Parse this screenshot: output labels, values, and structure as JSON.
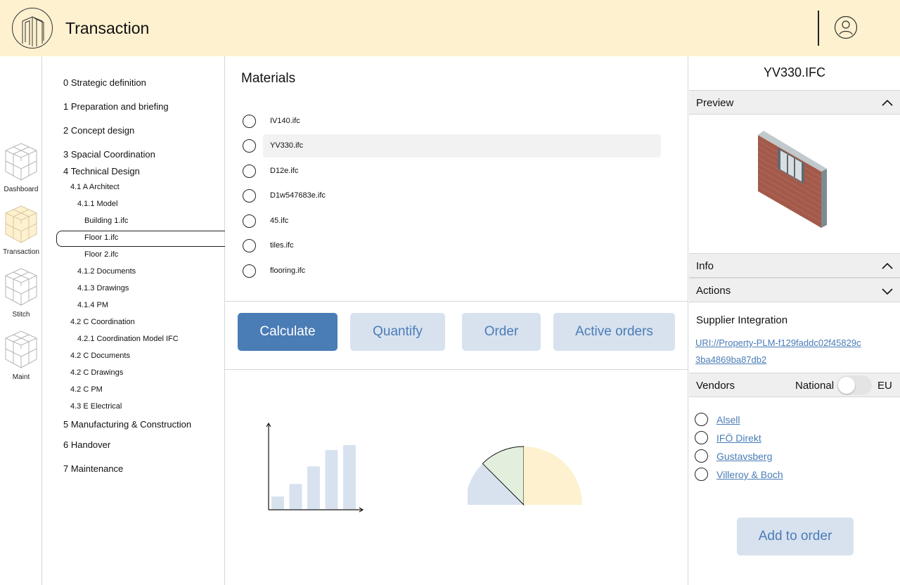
{
  "header": {
    "title": "Transaction"
  },
  "rail": {
    "items": [
      {
        "label": "Dashboard",
        "icon": "cube-stack-icon",
        "active": false
      },
      {
        "label": "Transaction",
        "icon": "cube-stack-icon",
        "active": true
      },
      {
        "label": "Stitch",
        "icon": "cube-stack-icon",
        "active": false
      },
      {
        "label": "Maint",
        "icon": "cube-stack-icon",
        "active": false
      }
    ]
  },
  "tree": {
    "items": [
      {
        "label": "0 Strategic definition"
      },
      {
        "label": "1 Preparation and briefing"
      },
      {
        "label": "2 Concept design"
      },
      {
        "label": "3 Spacial Coordination"
      },
      {
        "label": "4 Technical Design"
      },
      {
        "label": "4.1  A Architect"
      },
      {
        "label": "4.1.1 Model"
      },
      {
        "label": "Building 1.ifc"
      },
      {
        "label": "Floor 1.ifc"
      },
      {
        "label": "Floor 2.ifc"
      },
      {
        "label": "4.1.2 Documents"
      },
      {
        "label": "4.1.3 Drawings"
      },
      {
        "label": "4.1.4 PM"
      },
      {
        "label": "4.2 C Coordination"
      },
      {
        "label": "4.2.1 Coordination Model IFC"
      },
      {
        "label": "4.2 C Documents"
      },
      {
        "label": "4.2 C Drawings"
      },
      {
        "label": "4.2 C PM"
      },
      {
        "label": "4.3 E Electrical"
      },
      {
        "label": "5 Manufacturing & Construction"
      },
      {
        "label": "6 Handover"
      },
      {
        "label": "7 Maintenance"
      }
    ],
    "selected": "Floor 1.ifc"
  },
  "materials": {
    "title": "Materials",
    "items": [
      {
        "label": "IV140.ifc"
      },
      {
        "label": "YV330.ifc"
      },
      {
        "label": "D12e.ifc"
      },
      {
        "label": "D1w547683e.ifc"
      },
      {
        "label": "45.ifc"
      },
      {
        "label": "tiles.ifc"
      },
      {
        "label": "flooring.ifc"
      }
    ],
    "highlighted": "YV330.ifc"
  },
  "actions": {
    "calculate": "Calculate",
    "quantify": "Quantify",
    "order": "Order",
    "active_orders": "Active orders"
  },
  "chart_data": [
    {
      "type": "bar",
      "values": [
        1,
        2,
        3.4,
        4.7,
        5.1
      ],
      "colors": [
        "#d8e2ef"
      ]
    },
    {
      "type": "pie",
      "values": [
        45,
        45,
        90
      ],
      "colors": [
        "#d8e2ef",
        "#e2efdc",
        "#fdf1cf"
      ]
    }
  ],
  "details": {
    "file_title": "YV330.IFC",
    "preview_label": "Preview",
    "info_label": "Info",
    "actions_label": "Actions",
    "supplier_title": "Supplier Integration",
    "uri": "URI://Property-PLM-f129faddc02f45829c3ba4869ba87db2",
    "vendors_label": "Vendors",
    "toggle_left": "National",
    "toggle_right": "EU",
    "vendors": [
      {
        "label": "Alsell"
      },
      {
        "label": "IFÖ Direkt"
      },
      {
        "label": "Gustavsberg"
      },
      {
        "label": "Villeroy & Boch"
      }
    ],
    "add_to_order": "Add to order"
  },
  "colors": {
    "header_bg": "#fdf1cf",
    "accent": "#4a7cb6",
    "secondary_btn": "#d8e2ef"
  }
}
